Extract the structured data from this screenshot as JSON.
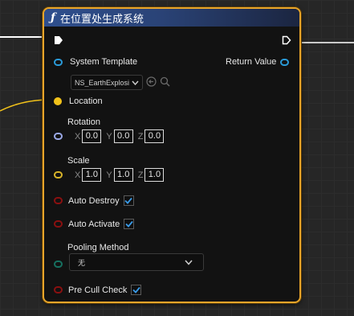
{
  "node": {
    "title": "在位置处生成系统",
    "title_icon": "function-icon"
  },
  "exec": {
    "in_icon": "exec-pin-in",
    "out_icon": "exec-pin-out"
  },
  "inputs": {
    "system_template": {
      "label": "System Template",
      "value": "NS_EarthExplosi"
    },
    "location": {
      "label": "Location"
    },
    "rotation": {
      "label": "Rotation",
      "x_label": "X",
      "x": "0.0",
      "y_label": "Y",
      "y": "0.0",
      "z_label": "Z",
      "z": "0.0"
    },
    "scale": {
      "label": "Scale",
      "x_label": "X",
      "x": "1.0",
      "y_label": "Y",
      "y": "1.0",
      "z_label": "Z",
      "z": "1.0"
    },
    "auto_destroy": {
      "label": "Auto Destroy",
      "checked": true
    },
    "auto_activate": {
      "label": "Auto Activate",
      "checked": true
    },
    "pooling_method": {
      "label": "Pooling Method",
      "value": "无"
    },
    "pre_cull_check": {
      "label": "Pre Cull Check",
      "checked": true
    }
  },
  "outputs": {
    "return_value": {
      "label": "Return Value"
    }
  },
  "colors": {
    "node_border": "#e8a52a",
    "header": "#2f4f8e",
    "object_pin": "#2a9ad8",
    "vector_pin": "#f2c21a",
    "rotator_pin": "#9aa8e6",
    "bool_pin": "#8a1010",
    "enum_pin": "#167060",
    "check_blue": "#3a9be8"
  }
}
